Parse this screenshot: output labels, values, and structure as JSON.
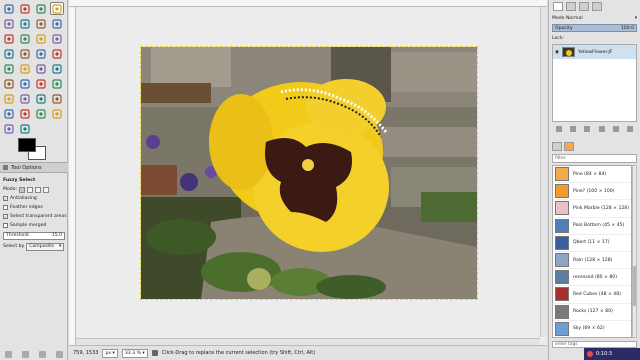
{
  "toolbox": {
    "tools": [
      "rect-select-icon",
      "ellipse-select-icon",
      "lasso-icon",
      "fuzzy-select-icon",
      "color-select-icon",
      "scissors-icon",
      "foreground-select-icon",
      "paths-icon",
      "color-picker-icon",
      "zoom-icon",
      "measure-icon",
      "move-icon",
      "align-icon",
      "crop-icon",
      "rotate-icon",
      "scale-icon",
      "shear-icon",
      "perspective-icon",
      "flip-icon",
      "cage-icon",
      "text-icon",
      "bucket-fill-icon",
      "gradient-icon",
      "pencil-icon",
      "paintbrush-icon",
      "eraser-icon",
      "airbrush-icon",
      "ink-icon",
      "clone-icon",
      "heal-icon",
      "perspective-clone-icon",
      "blur-icon",
      "smudge-icon",
      "dodge-burn-icon"
    ],
    "active_tool_index": 3,
    "foreground_color": "#000000",
    "background_color": "#ffffff",
    "tool_options_title": "Tool Options",
    "tool_name": "Fuzzy Select",
    "mode_label": "Mode:",
    "antialiasing_label": "Antialiasing",
    "antialiasing_checked": "✓",
    "feather_label": "Feather edges",
    "select_transparent_label": "Select transparent areas",
    "select_transparent_checked": "✓",
    "sample_merged_label": "Sample merged",
    "threshold_label": "Threshold",
    "threshold_value": "15.0",
    "select_by_label": "Select by",
    "select_by_value": "Composite"
  },
  "status": {
    "coords": "759, 1533",
    "unit": "px",
    "zoom": "33.3 %",
    "message": "Click-Drag to replace the current selection (try Shift, Ctrl, Alt)"
  },
  "dock": {
    "mode_label": "Mode",
    "mode_value": "Normal",
    "opacity_label": "Opacity",
    "opacity_value": "100.0",
    "lock_label": "Lock:",
    "layer_name": "YellowFlower.JF",
    "filter_placeholder": "filter",
    "patterns": [
      {
        "name": "Pine (84 × 84)",
        "color": "#f5a94a"
      },
      {
        "name": "Pine? (100 × 100)",
        "color": "#f29a2e"
      },
      {
        "name": "Pink Marble (128 × 128)",
        "color": "#e9c1c6"
      },
      {
        "name": "Pool Bottom (45 × 45)",
        "color": "#4e7fb6"
      },
      {
        "name": "Qbert (11 × 17)",
        "color": "#3a5f9e"
      },
      {
        "name": "Rain (128 × 128)",
        "color": "#8aa6c4"
      },
      {
        "name": "recessed (80 × 80)",
        "color": "#5c7ca2"
      },
      {
        "name": "Red Cubes (48 × 48)",
        "color": "#a8302c"
      },
      {
        "name": "Rocks (127 × 80)",
        "color": "#7a7a78"
      },
      {
        "name": "Sky (69 × 62)",
        "color": "#6f9bd6"
      }
    ],
    "tag_placeholder": "enter tags"
  },
  "recording": {
    "time": "0:10:3"
  }
}
